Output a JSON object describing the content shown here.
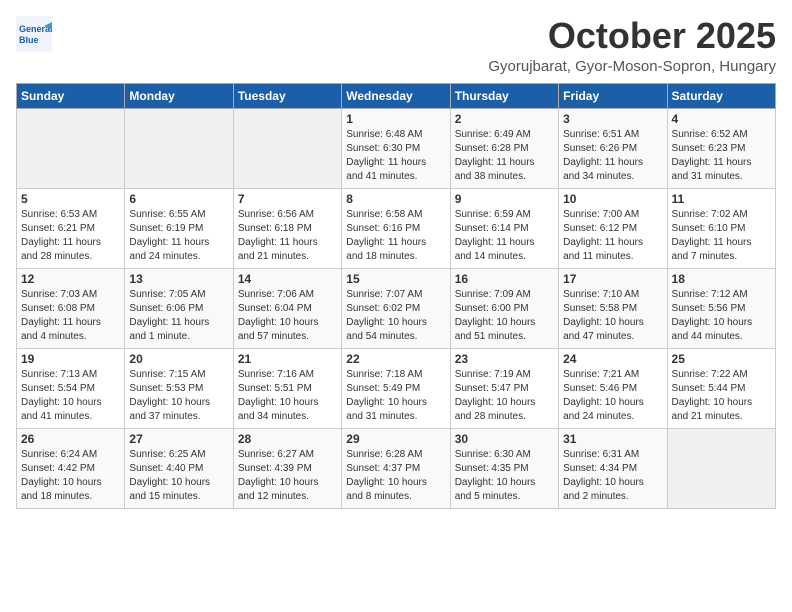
{
  "header": {
    "logo_line1": "General",
    "logo_line2": "Blue",
    "month": "October 2025",
    "location": "Gyorujbarat, Gyor-Moson-Sopron, Hungary"
  },
  "days_of_week": [
    "Sunday",
    "Monday",
    "Tuesday",
    "Wednesday",
    "Thursday",
    "Friday",
    "Saturday"
  ],
  "weeks": [
    [
      {
        "day": "",
        "info": ""
      },
      {
        "day": "",
        "info": ""
      },
      {
        "day": "",
        "info": ""
      },
      {
        "day": "1",
        "info": "Sunrise: 6:48 AM\nSunset: 6:30 PM\nDaylight: 11 hours\nand 41 minutes."
      },
      {
        "day": "2",
        "info": "Sunrise: 6:49 AM\nSunset: 6:28 PM\nDaylight: 11 hours\nand 38 minutes."
      },
      {
        "day": "3",
        "info": "Sunrise: 6:51 AM\nSunset: 6:26 PM\nDaylight: 11 hours\nand 34 minutes."
      },
      {
        "day": "4",
        "info": "Sunrise: 6:52 AM\nSunset: 6:23 PM\nDaylight: 11 hours\nand 31 minutes."
      }
    ],
    [
      {
        "day": "5",
        "info": "Sunrise: 6:53 AM\nSunset: 6:21 PM\nDaylight: 11 hours\nand 28 minutes."
      },
      {
        "day": "6",
        "info": "Sunrise: 6:55 AM\nSunset: 6:19 PM\nDaylight: 11 hours\nand 24 minutes."
      },
      {
        "day": "7",
        "info": "Sunrise: 6:56 AM\nSunset: 6:18 PM\nDaylight: 11 hours\nand 21 minutes."
      },
      {
        "day": "8",
        "info": "Sunrise: 6:58 AM\nSunset: 6:16 PM\nDaylight: 11 hours\nand 18 minutes."
      },
      {
        "day": "9",
        "info": "Sunrise: 6:59 AM\nSunset: 6:14 PM\nDaylight: 11 hours\nand 14 minutes."
      },
      {
        "day": "10",
        "info": "Sunrise: 7:00 AM\nSunset: 6:12 PM\nDaylight: 11 hours\nand 11 minutes."
      },
      {
        "day": "11",
        "info": "Sunrise: 7:02 AM\nSunset: 6:10 PM\nDaylight: 11 hours\nand 7 minutes."
      }
    ],
    [
      {
        "day": "12",
        "info": "Sunrise: 7:03 AM\nSunset: 6:08 PM\nDaylight: 11 hours\nand 4 minutes."
      },
      {
        "day": "13",
        "info": "Sunrise: 7:05 AM\nSunset: 6:06 PM\nDaylight: 11 hours\nand 1 minute."
      },
      {
        "day": "14",
        "info": "Sunrise: 7:06 AM\nSunset: 6:04 PM\nDaylight: 10 hours\nand 57 minutes."
      },
      {
        "day": "15",
        "info": "Sunrise: 7:07 AM\nSunset: 6:02 PM\nDaylight: 10 hours\nand 54 minutes."
      },
      {
        "day": "16",
        "info": "Sunrise: 7:09 AM\nSunset: 6:00 PM\nDaylight: 10 hours\nand 51 minutes."
      },
      {
        "day": "17",
        "info": "Sunrise: 7:10 AM\nSunset: 5:58 PM\nDaylight: 10 hours\nand 47 minutes."
      },
      {
        "day": "18",
        "info": "Sunrise: 7:12 AM\nSunset: 5:56 PM\nDaylight: 10 hours\nand 44 minutes."
      }
    ],
    [
      {
        "day": "19",
        "info": "Sunrise: 7:13 AM\nSunset: 5:54 PM\nDaylight: 10 hours\nand 41 minutes."
      },
      {
        "day": "20",
        "info": "Sunrise: 7:15 AM\nSunset: 5:53 PM\nDaylight: 10 hours\nand 37 minutes."
      },
      {
        "day": "21",
        "info": "Sunrise: 7:16 AM\nSunset: 5:51 PM\nDaylight: 10 hours\nand 34 minutes."
      },
      {
        "day": "22",
        "info": "Sunrise: 7:18 AM\nSunset: 5:49 PM\nDaylight: 10 hours\nand 31 minutes."
      },
      {
        "day": "23",
        "info": "Sunrise: 7:19 AM\nSunset: 5:47 PM\nDaylight: 10 hours\nand 28 minutes."
      },
      {
        "day": "24",
        "info": "Sunrise: 7:21 AM\nSunset: 5:46 PM\nDaylight: 10 hours\nand 24 minutes."
      },
      {
        "day": "25",
        "info": "Sunrise: 7:22 AM\nSunset: 5:44 PM\nDaylight: 10 hours\nand 21 minutes."
      }
    ],
    [
      {
        "day": "26",
        "info": "Sunrise: 6:24 AM\nSunset: 4:42 PM\nDaylight: 10 hours\nand 18 minutes."
      },
      {
        "day": "27",
        "info": "Sunrise: 6:25 AM\nSunset: 4:40 PM\nDaylight: 10 hours\nand 15 minutes."
      },
      {
        "day": "28",
        "info": "Sunrise: 6:27 AM\nSunset: 4:39 PM\nDaylight: 10 hours\nand 12 minutes."
      },
      {
        "day": "29",
        "info": "Sunrise: 6:28 AM\nSunset: 4:37 PM\nDaylight: 10 hours\nand 8 minutes."
      },
      {
        "day": "30",
        "info": "Sunrise: 6:30 AM\nSunset: 4:35 PM\nDaylight: 10 hours\nand 5 minutes."
      },
      {
        "day": "31",
        "info": "Sunrise: 6:31 AM\nSunset: 4:34 PM\nDaylight: 10 hours\nand 2 minutes."
      },
      {
        "day": "",
        "info": ""
      }
    ]
  ]
}
